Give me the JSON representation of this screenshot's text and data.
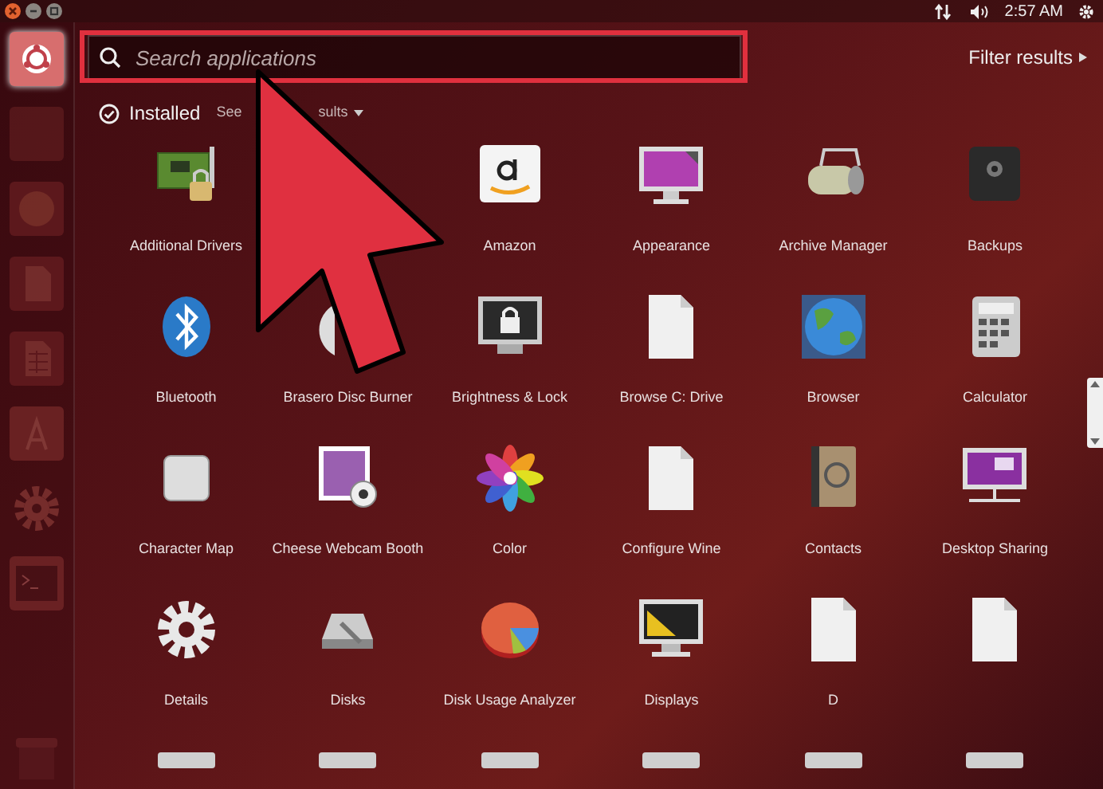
{
  "top_panel": {
    "time": "2:57 AM"
  },
  "launcher": [
    {
      "kind": "dash",
      "selected": true
    },
    {
      "kind": "tile",
      "selected": false
    },
    {
      "kind": "globe",
      "selected": false
    },
    {
      "kind": "document",
      "selected": false
    },
    {
      "kind": "spreadsheet",
      "selected": false
    },
    {
      "kind": "letter",
      "selected": false
    },
    {
      "kind": "gear",
      "selected": false
    },
    {
      "kind": "terminal",
      "selected": false
    },
    {
      "kind": "trash",
      "selected": false
    }
  ],
  "search": {
    "placeholder": "Search applications"
  },
  "filter_results": "Filter results",
  "section": {
    "title": "Installed",
    "see_more_start": "See",
    "see_more_end": "sults"
  },
  "apps": [
    {
      "kind": "board",
      "label": "Additional Drivers"
    },
    {
      "kind": "covered"
    },
    {
      "kind": "amazon",
      "label": "Amazon"
    },
    {
      "kind": "monitor",
      "label": "Appearance"
    },
    {
      "kind": "roller",
      "label": "Archive Manager"
    },
    {
      "kind": "safe",
      "label": "Backups"
    },
    {
      "kind": "bluetooth",
      "label": "Bluetooth"
    },
    {
      "kind": "disc",
      "label": "Brasero Disc Burner"
    },
    {
      "kind": "lockmonitor",
      "label": "Brightness & Lock"
    },
    {
      "kind": "document",
      "label": "Browse C: Drive"
    },
    {
      "kind": "globe",
      "label": "Browser"
    },
    {
      "kind": "calculator",
      "label": "Calculator"
    },
    {
      "kind": "keycap",
      "label": "Character Map"
    },
    {
      "kind": "photo",
      "label": "Cheese Webcam Booth"
    },
    {
      "kind": "flower",
      "label": "Color"
    },
    {
      "kind": "document",
      "label": "Configure Wine"
    },
    {
      "kind": "book",
      "label": "Contacts"
    },
    {
      "kind": "sharemonitor",
      "label": "Desktop Sharing"
    },
    {
      "kind": "gear",
      "label": "Details"
    },
    {
      "kind": "drive",
      "label": "Disks"
    },
    {
      "kind": "pie",
      "label": "Disk Usage Analyzer"
    },
    {
      "kind": "rulermonitor",
      "label": "Displays"
    },
    {
      "kind": "document",
      "label": "D"
    },
    {
      "kind": "document"
    },
    {
      "kind": "partial"
    },
    {
      "kind": "partial"
    },
    {
      "kind": "partial"
    },
    {
      "kind": "partial"
    },
    {
      "kind": "partial"
    },
    {
      "kind": "partial"
    }
  ]
}
